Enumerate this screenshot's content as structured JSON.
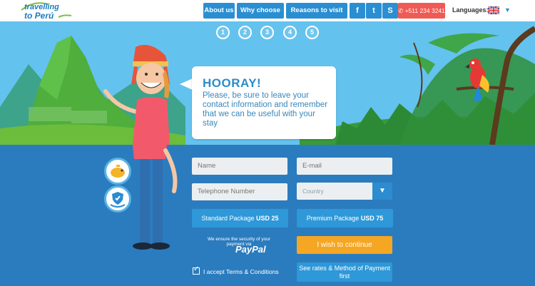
{
  "header": {
    "logo": {
      "line1": "travelling",
      "line2": "to Perú"
    },
    "nav": {
      "about": "About us",
      "why": "Why choose us?",
      "reasons": "Reasons to visit Peru"
    },
    "social": {
      "facebook_glyph": "f",
      "twitter_glyph": "t",
      "skype_glyph": "S"
    },
    "phone": "+511 234 3241",
    "languages_label": "Languages:",
    "language_flag": "uk-flag-icon",
    "caret_glyph": "▼"
  },
  "steps": [
    "1",
    "2",
    "3",
    "4",
    "5"
  ],
  "bubble": {
    "title": "HOORAY!",
    "text": "Please, be sure to leave your contact information and remember that we can be useful with your stay"
  },
  "form": {
    "name_placeholder": "Name",
    "email_placeholder": "E-mail",
    "phone_placeholder": "Telephone Number",
    "country_value": "Country",
    "country_caret": "▼",
    "standard_label": "Standard Package ",
    "standard_price": "USD 25",
    "premium_label": "Premium Package ",
    "premium_price": "USD 75",
    "security_text": "We ensure the security of your payment via",
    "paypal": "PayPal",
    "continue": "I wish to continue",
    "rates": "See rates & Method of Payment first",
    "terms": "I accept Terms & Conditions",
    "terms_checked": true,
    "check_glyph": "✓"
  },
  "colors": {
    "header_button": "#2a8fd2",
    "phone_button": "#ef5a55",
    "continue_button": "#f5a623",
    "package_button": "#2e98d8",
    "sky": "#64c2ee",
    "ground": "#2b7cbe"
  }
}
